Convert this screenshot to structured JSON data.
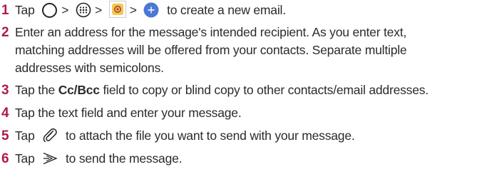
{
  "steps": [
    {
      "num": "1",
      "parts": {
        "tap": "Tap",
        "gt1": ">",
        "gt2": ">",
        "gt3": ">",
        "end": "to create a new email."
      },
      "icons": [
        "home-circle-icon",
        "apps-icon",
        "email-app-icon",
        "compose-icon"
      ]
    },
    {
      "num": "2",
      "text": "Enter an address for the message's intended recipient. As you enter text, matching addresses will be offered from your contacts. Separate multiple addresses with semicolons."
    },
    {
      "num": "3",
      "parts": {
        "tap": "Tap the",
        "field": "Cc/Bcc",
        "end": "field to copy or blind copy to other contacts/email addresses."
      }
    },
    {
      "num": "4",
      "text": "Tap the text field and enter your message."
    },
    {
      "num": "5",
      "parts": {
        "tap": "Tap",
        "end": "to attach the file you want to send with your message."
      },
      "icons": [
        "paperclip-icon"
      ]
    },
    {
      "num": "6",
      "parts": {
        "tap": "Tap",
        "end": "to send the message."
      },
      "icons": [
        "send-icon"
      ]
    }
  ],
  "colors": {
    "step_number": "#b0174f",
    "text": "#2b2b2b",
    "email_icon_bg": "#f2c94c",
    "compose_icon_bg": "#4a78d4"
  }
}
